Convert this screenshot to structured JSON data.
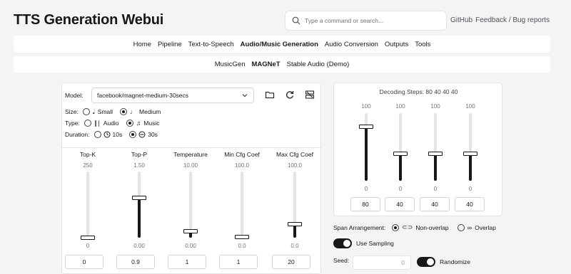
{
  "app": {
    "title": "TTS Generation Webui"
  },
  "search": {
    "placeholder": "Type a command or search..."
  },
  "top_links": {
    "github": "GitHub",
    "feedback": "Feedback / Bug reports",
    "separator": ""
  },
  "nav": {
    "items": [
      "Home",
      "Pipeline",
      "Text-to-Speech",
      "Audio/Music Generation",
      "Audio Conversion",
      "Outputs",
      "Tools"
    ],
    "active": "Audio/Music Generation"
  },
  "subnav": {
    "items": [
      "MusicGen",
      "MAGNeT",
      "Stable Audio (Demo)"
    ],
    "active": "MAGNeT"
  },
  "model": {
    "label": "Model:",
    "value": "facebook/magnet-medium-30secs"
  },
  "size": {
    "label": "Size:",
    "options": [
      "Small",
      "Medium"
    ],
    "selected": "Medium"
  },
  "type": {
    "label": "Type:",
    "options": [
      "Audio",
      "Music"
    ],
    "selected": "Music"
  },
  "duration": {
    "label": "Duration:",
    "options": [
      "10s",
      "30s"
    ],
    "selected": "30s"
  },
  "sliders": [
    {
      "label": "Top-K",
      "max": "250",
      "min": "0",
      "value": "0",
      "level": 0.0
    },
    {
      "label": "Top-P",
      "max": "1.50",
      "min": "0.00",
      "value": "0.9",
      "level": 0.6
    },
    {
      "label": "Temperature",
      "max": "10.00",
      "min": "0.00",
      "value": "1",
      "level": 0.1
    },
    {
      "label": "Min Cfg Coef",
      "max": "100.0",
      "min": "0.0",
      "value": "1",
      "level": 0.01
    },
    {
      "label": "Max Cfg Coef",
      "max": "100.0",
      "min": "0.0",
      "value": "20",
      "level": 0.2
    }
  ],
  "decoding": {
    "title": "Decoding Steps: 80 40 40 40",
    "steps": [
      {
        "max": "100",
        "min": "0",
        "value": "80",
        "level": 0.8
      },
      {
        "max": "100",
        "min": "0",
        "value": "40",
        "level": 0.4
      },
      {
        "max": "100",
        "min": "0",
        "value": "40",
        "level": 0.4
      },
      {
        "max": "100",
        "min": "0",
        "value": "40",
        "level": 0.4
      }
    ]
  },
  "span": {
    "label": "Span Arrangement:",
    "options": [
      "Non-overlap",
      "Overlap"
    ],
    "selected": "Non-overlap"
  },
  "use_sampling": {
    "label": "Use Sampling",
    "on": true
  },
  "seed": {
    "label": "Seed:",
    "value": "0"
  },
  "randomize": {
    "label": "Randomize",
    "on": true
  }
}
